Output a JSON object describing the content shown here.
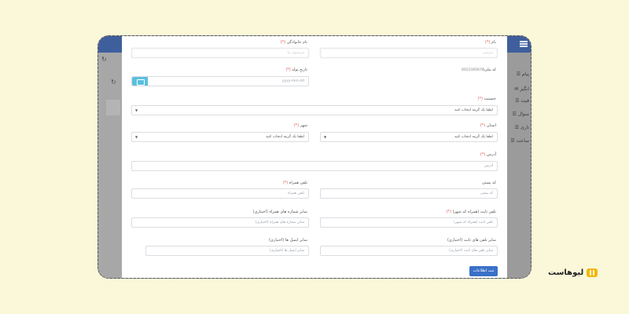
{
  "background_rows": [
    "پیام",
    "انگیز",
    "فیت",
    "سوال",
    "تاری",
    "ساعت"
  ],
  "form": {
    "first_name": {
      "label": "نام",
      "value": "مرتضی"
    },
    "last_name": {
      "label": "نام خانوادگی",
      "value": "مرتضوی نیا"
    },
    "national_code": {
      "label": "کد ملی:",
      "value": "0012345678"
    },
    "birth_date": {
      "label": "تاریخ تولد",
      "placeholder": "yyyy-mm-dd"
    },
    "gender": {
      "label": "جنسیت",
      "value": "لطفا یک گزینه انتخاب کنید"
    },
    "province": {
      "label": "استان",
      "value": "لطفا یک گزینه انتخاب کنید"
    },
    "city": {
      "label": "شهر",
      "value": "لطفا یک گزینه انتخاب کنید"
    },
    "address": {
      "label": "آدرس",
      "placeholder": "آدرس"
    },
    "postal_code": {
      "label": "کد پستی",
      "placeholder": "کد پستی"
    },
    "mobile": {
      "label": "تلفن همراه",
      "placeholder": "تلفن همراه"
    },
    "landline": {
      "label": "تلفن ثابت (همراه کد شهر)",
      "placeholder": "تلفن ثابت (همراه کد شهر)"
    },
    "other_mobiles": {
      "label": "سایر شماره های همراه (اختیاری)",
      "placeholder": "سایر شماره های همراه (اختیاری)"
    },
    "other_landlines": {
      "label": "سایر تلفن های ثابت (اختیاری)",
      "placeholder": "سایر تلفن های ثابت (اختیاری)"
    },
    "other_emails": {
      "label": "سایر ایمیل ها (اختیاری)",
      "placeholder": "سایر ایمیل ها (اختیاری)"
    },
    "required_mark": "(*)",
    "submit_label": "ثبت اطلاعات"
  },
  "brand": {
    "name": "لیوهاست"
  },
  "colors": {
    "accent": "#3a70c8",
    "calendar": "#5bc0de",
    "required": "#d9534f",
    "background": "#fbf8da"
  }
}
